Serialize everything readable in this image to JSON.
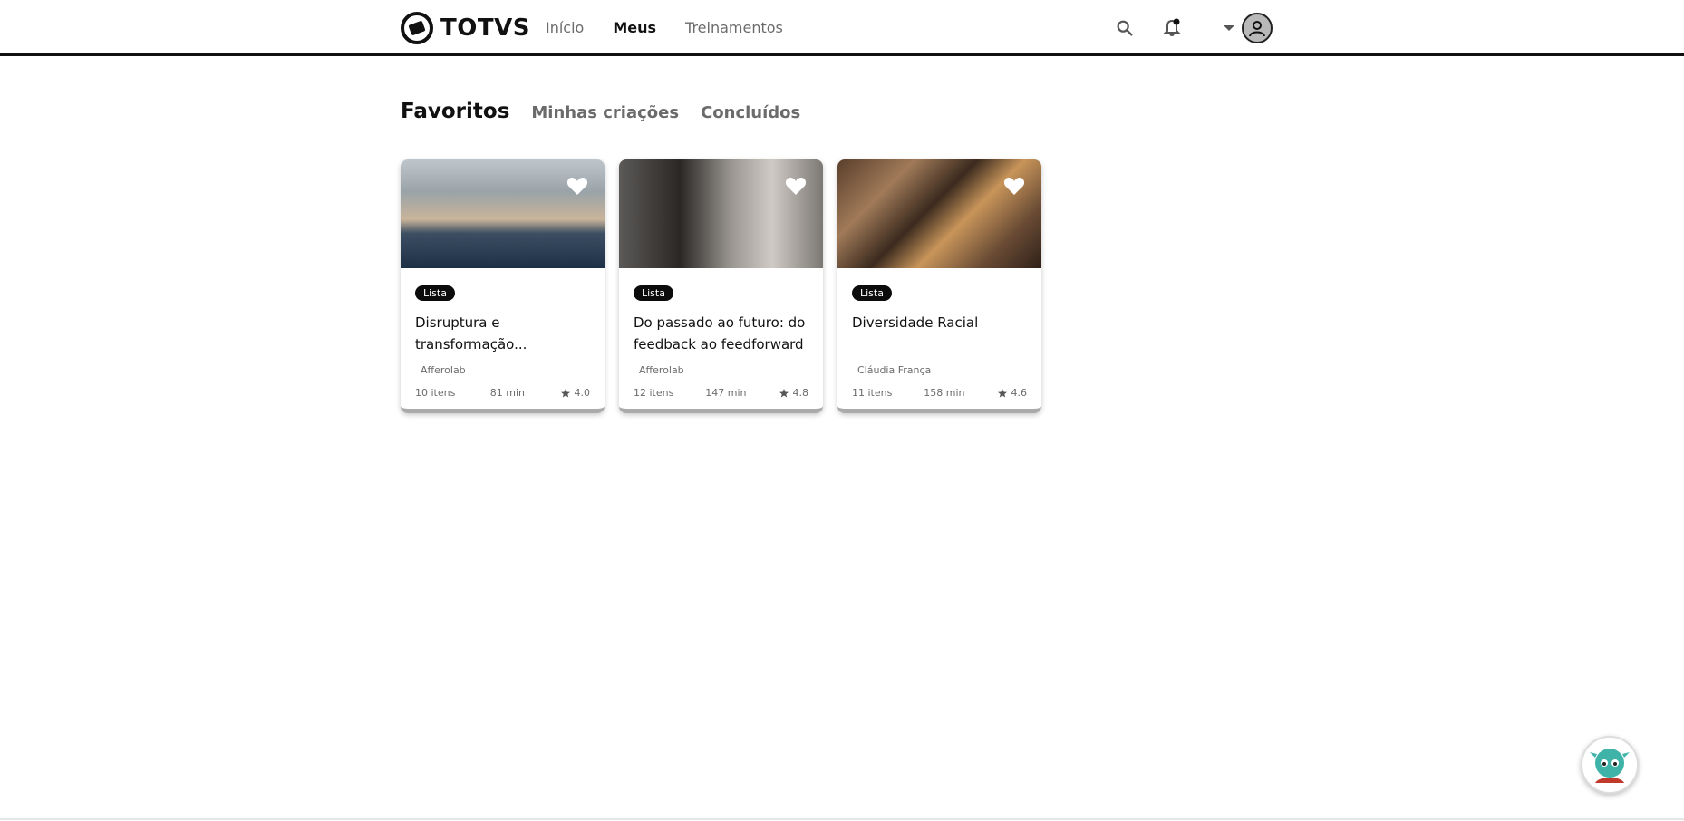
{
  "header": {
    "logo_text": "TOTVS",
    "nav": [
      {
        "label": "Início"
      },
      {
        "label": "Meus"
      },
      {
        "label": "Treinamentos"
      }
    ]
  },
  "tabs": [
    {
      "label": "Favoritos"
    },
    {
      "label": "Minhas criações"
    },
    {
      "label": "Concluídos"
    }
  ],
  "cards": [
    {
      "badge": "Lista",
      "title": "Disruptura e transformação...",
      "author": "Afferolab",
      "items": "10 itens",
      "duration": "81 min",
      "rating": "4.0"
    },
    {
      "badge": "Lista",
      "title": "Do passado ao futuro: do feedback ao feedforward",
      "author": "Afferolab",
      "items": "12 itens",
      "duration": "147 min",
      "rating": "4.8"
    },
    {
      "badge": "Lista",
      "title": "Diversidade Racial",
      "author": "Cláudia França",
      "items": "11 itens",
      "duration": "158 min",
      "rating": "4.6"
    }
  ],
  "colors": {
    "accent": "#111111",
    "muted": "#6b6b6b"
  }
}
